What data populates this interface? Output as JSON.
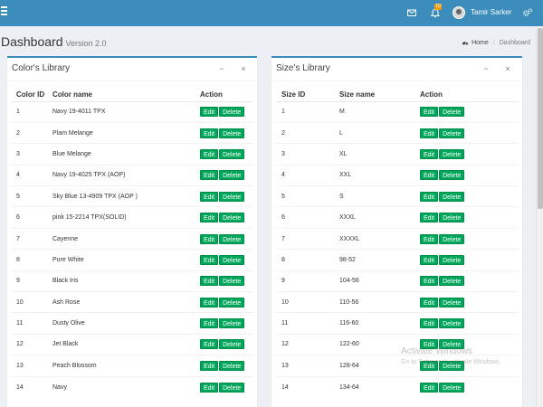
{
  "navbar": {
    "user_name": "Tamir Sarker",
    "notification_count": "10",
    "accent_color": "#3c8dbc",
    "icons": [
      "hamburger-menu-icon",
      "envelope-icon",
      "bell-icon",
      "gears-icon"
    ]
  },
  "header": {
    "title": "Dashboard",
    "subtitle": "Version 2.0",
    "breadcrumb": {
      "home": "Home",
      "current": "Dashboard"
    }
  },
  "colors_box": {
    "title": "Color's Library",
    "columns": [
      "Color ID",
      "Color name",
      "Action"
    ],
    "rows": [
      {
        "id": "1",
        "name": "Navy 19-4011 TPX"
      },
      {
        "id": "2",
        "name": "Plam Melange"
      },
      {
        "id": "3",
        "name": "Blue Melange"
      },
      {
        "id": "4",
        "name": "Navy 19-4025 TPX (AOP)"
      },
      {
        "id": "5",
        "name": "Sky Blue 13-4909 TPX (AOP )"
      },
      {
        "id": "6",
        "name": "pink 15-2214 TPX(SOLID)"
      },
      {
        "id": "7",
        "name": "Cayenne"
      },
      {
        "id": "8",
        "name": "Pure White"
      },
      {
        "id": "9",
        "name": "Black Iris"
      },
      {
        "id": "10",
        "name": "Ash Rose"
      },
      {
        "id": "11",
        "name": "Dusty Olive"
      },
      {
        "id": "12",
        "name": "Jet Black"
      },
      {
        "id": "13",
        "name": "Peach Blossom"
      },
      {
        "id": "14",
        "name": "Navy"
      }
    ]
  },
  "sizes_box": {
    "title": "Size's Library",
    "columns": [
      "Size ID",
      "Size name",
      "Action"
    ],
    "rows": [
      {
        "id": "1",
        "name": "M"
      },
      {
        "id": "2",
        "name": "L"
      },
      {
        "id": "3",
        "name": "XL"
      },
      {
        "id": "4",
        "name": "XXL"
      },
      {
        "id": "5",
        "name": "S"
      },
      {
        "id": "6",
        "name": "XXXL"
      },
      {
        "id": "7",
        "name": "XXXXL"
      },
      {
        "id": "8",
        "name": "98-52"
      },
      {
        "id": "9",
        "name": "104-56"
      },
      {
        "id": "10",
        "name": "110-56"
      },
      {
        "id": "11",
        "name": "116-60"
      },
      {
        "id": "12",
        "name": "122-60"
      },
      {
        "id": "13",
        "name": "128-64"
      },
      {
        "id": "14",
        "name": "134-64"
      }
    ]
  },
  "actions": {
    "edit": "Edit",
    "delete": "Delete"
  },
  "box_tools": {
    "minimize": "−",
    "close": "×"
  },
  "watermark": {
    "line1": "Activate Windows",
    "line2": "Go to Settings to activate Windows."
  },
  "colors": {
    "action_button": "#00a65a",
    "background": "#ecf0f5"
  }
}
